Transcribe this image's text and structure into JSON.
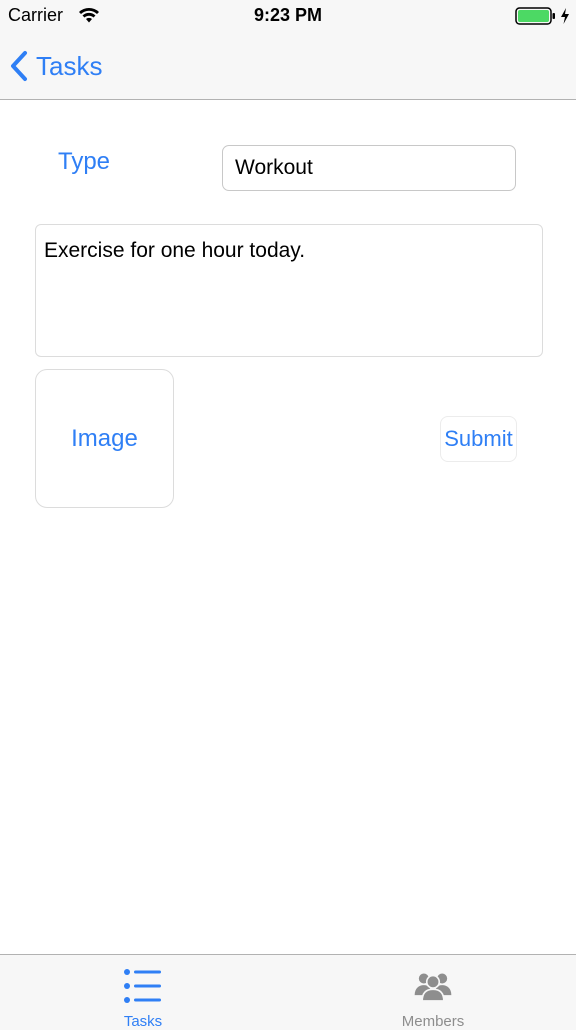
{
  "status_bar": {
    "carrier": "Carrier",
    "time": "9:23 PM",
    "battery_color": "#4cd964"
  },
  "nav": {
    "back_label": "Tasks",
    "accent_color": "#2f7ff5"
  },
  "form": {
    "type_label": "Type",
    "type_value": "Workout",
    "description_value": "Exercise for one hour today.",
    "image_button_label": "Image",
    "submit_button_label": "Submit"
  },
  "tab_bar": {
    "tabs": [
      {
        "label": "Tasks",
        "icon": "list-icon",
        "selected": true
      },
      {
        "label": "Members",
        "icon": "group-icon",
        "selected": false
      }
    ]
  }
}
